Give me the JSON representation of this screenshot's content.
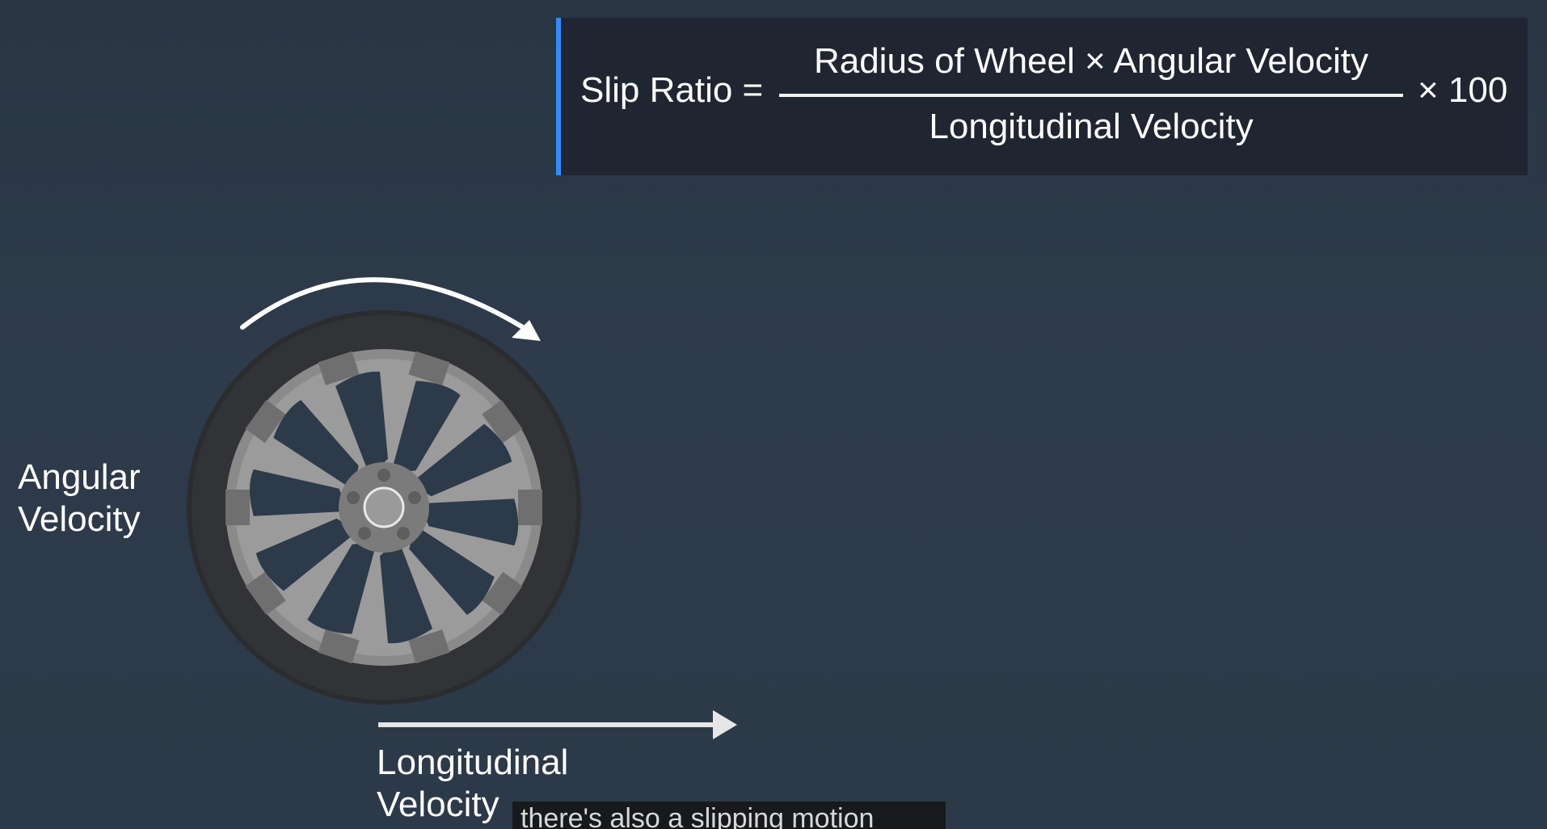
{
  "formula": {
    "lhs": "Slip Ratio =",
    "numerator": "Radius of Wheel  × Angular Velocity",
    "denominator": "Longitudinal Velocity",
    "multiplier": "× 100",
    "accent_color": "#2f8cff"
  },
  "labels": {
    "angular_line1": "Angular",
    "angular_line2": "Velocity",
    "longitudinal_line1": "Longitudinal",
    "longitudinal_line2": "Velocity"
  },
  "caption": {
    "text": "there's also a slipping motion"
  },
  "icons": {
    "wheel": "wheel-icon",
    "rotation_arrow": "curved-arrow-icon",
    "direction_arrow": "right-arrow-icon"
  }
}
